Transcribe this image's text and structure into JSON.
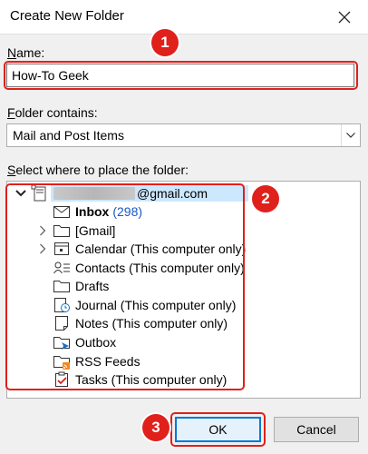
{
  "dialog": {
    "title": "Create New Folder"
  },
  "name_field": {
    "label_accel": "N",
    "label_rest": "ame:",
    "value": "How-To Geek"
  },
  "folder_contains": {
    "label_accel": "F",
    "label_rest": "older contains:",
    "selected": "Mail and Post Items"
  },
  "location": {
    "label_accel": "S",
    "label_rest": "elect where to place the folder:",
    "root": {
      "account_suffix": "@gmail.com"
    },
    "items": [
      {
        "label": "Inbox",
        "count": "(298)",
        "icon": "inbox-icon",
        "bold": true
      },
      {
        "label": "[Gmail]",
        "icon": "folder-icon",
        "expandable": true
      },
      {
        "label": "Calendar (This computer only)",
        "icon": "calendar-icon",
        "expandable": true
      },
      {
        "label": "Contacts (This computer only)",
        "icon": "contacts-icon"
      },
      {
        "label": "Drafts",
        "icon": "folder-icon"
      },
      {
        "label": "Journal (This computer only)",
        "icon": "journal-icon"
      },
      {
        "label": "Notes (This computer only)",
        "icon": "notes-icon"
      },
      {
        "label": "Outbox",
        "icon": "outbox-icon"
      },
      {
        "label": "RSS Feeds",
        "icon": "rss-icon"
      },
      {
        "label": "Tasks (This computer only)",
        "icon": "tasks-icon"
      }
    ]
  },
  "buttons": {
    "ok": "OK",
    "cancel": "Cancel"
  },
  "annotations": {
    "step1": "1",
    "step2": "2",
    "step3": "3",
    "color": "#e0201b"
  }
}
